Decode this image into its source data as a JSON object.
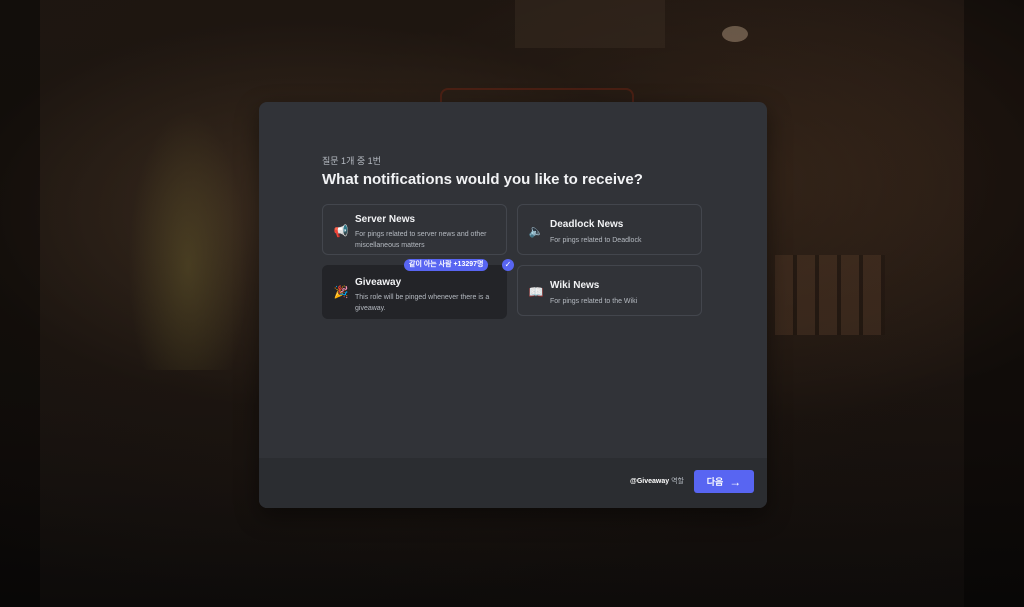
{
  "dialog": {
    "progress": "질문 1개 중 1번",
    "question": "What notifications would you like to receive?"
  },
  "options": [
    {
      "icon": "megaphone-icon",
      "glyph": "📢",
      "title": "Server News",
      "description": "For pings related to server news and other miscellaneous matters",
      "selected": false
    },
    {
      "icon": "speaker-icon",
      "glyph": "🔈",
      "title": "Deadlock News",
      "description": "For pings related to Deadlock",
      "selected": false
    },
    {
      "icon": "party-popper-icon",
      "glyph": "🎉",
      "title": "Giveaway",
      "description": "This role will be pinged whenever there is a giveaway.",
      "selected": true
    },
    {
      "icon": "book-icon",
      "glyph": "📖",
      "title": "Wiki News",
      "description": "For pings related to the Wiki",
      "selected": false
    }
  ],
  "selection_badge": "같이 아는 사람 +13297명",
  "footer": {
    "role_mention": "@Giveaway",
    "role_suffix": "역할",
    "next_label": "다음",
    "next_arrow": "→"
  },
  "colors": {
    "accent": "#5865f2",
    "modal_bg": "#313338",
    "footer_bg": "#2b2d31",
    "selected_bg": "#232428"
  }
}
